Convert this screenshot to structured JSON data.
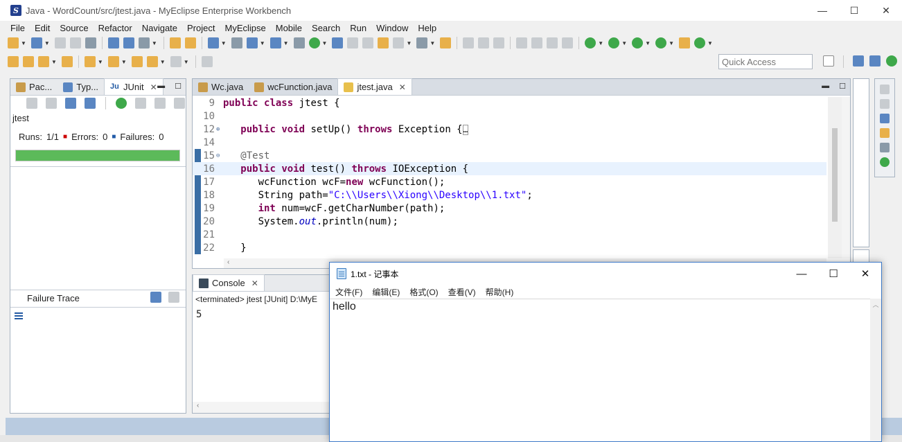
{
  "window": {
    "title": "Java - WordCount/src/jtest.java - MyEclipse Enterprise Workbench",
    "minimize": "—",
    "maximize": "☐",
    "close": "✕"
  },
  "menu": [
    "File",
    "Edit",
    "Source",
    "Refactor",
    "Navigate",
    "Project",
    "MyEclipse",
    "Mobile",
    "Search",
    "Run",
    "Window",
    "Help"
  ],
  "quick_access": {
    "placeholder": "Quick Access"
  },
  "left_panel": {
    "tabs": [
      {
        "label": "Pac..."
      },
      {
        "label": "Typ..."
      },
      {
        "label": "JUnit",
        "close": "✕"
      }
    ],
    "test_name": "jtest",
    "runs_label": "Runs:",
    "runs_value": "1/1",
    "errors_label": "Errors:",
    "errors_value": "0",
    "failures_label": "Failures:",
    "failures_value": "0",
    "progress": 1.0,
    "failure_trace_label": "Failure Trace"
  },
  "editor": {
    "tabs": [
      {
        "label": "Wc.java"
      },
      {
        "label": "wcFunction.java"
      },
      {
        "label": "jtest.java",
        "close": "✕"
      }
    ],
    "lines": [
      {
        "num": "9",
        "fold": ""
      },
      {
        "num": "10",
        "fold": ""
      },
      {
        "num": "12",
        "fold": "⊕"
      },
      {
        "num": "14",
        "fold": ""
      },
      {
        "num": "15",
        "fold": "⊖"
      },
      {
        "num": "16",
        "fold": ""
      },
      {
        "num": "17",
        "fold": ""
      },
      {
        "num": "18",
        "fold": ""
      },
      {
        "num": "19",
        "fold": ""
      },
      {
        "num": "20",
        "fold": ""
      },
      {
        "num": "21",
        "fold": ""
      },
      {
        "num": "22",
        "fold": ""
      }
    ],
    "code": {
      "l9_kw1": "public",
      "l9_kw2": "class",
      "l9_rest": " jtest {",
      "l12_kw1": "public",
      "l12_kw2": "void",
      "l12_mid": " setUp() ",
      "l12_kw3": "throws",
      "l12_rest": " Exception {",
      "l12_fold": "…",
      "l15_ann": "@Test",
      "l16_kw1": "public",
      "l16_kw2": "void",
      "l16_mid": " test() ",
      "l16_kw3": "throws",
      "l16_rest": " IOException {",
      "l17_a": "wcFunction wcF=",
      "l17_kw": "new",
      "l17_b": " wcFunction();",
      "l18_a": "String path=",
      "l18_str": "\"C:\\\\Users\\\\Xiong\\\\Desktop\\\\1.txt\"",
      "l18_b": ";",
      "l19_kw": "int",
      "l19_rest": " num=wcF.getCharNumber(path);",
      "l20_a": "System.",
      "l20_it": "out",
      "l20_b": ".println(num);",
      "l22": "}"
    }
  },
  "console": {
    "tab_label": "Console",
    "close": "✕",
    "status": "<terminated> jtest [JUnit] D:\\MyE",
    "output": "5"
  },
  "notepad": {
    "title": "1.txt - 记事本",
    "menu": [
      "文件(F)",
      "编辑(E)",
      "格式(O)",
      "查看(V)",
      "帮助(H)"
    ],
    "content": "hello",
    "minimize": "—",
    "maximize": "☐",
    "close": "✕"
  }
}
